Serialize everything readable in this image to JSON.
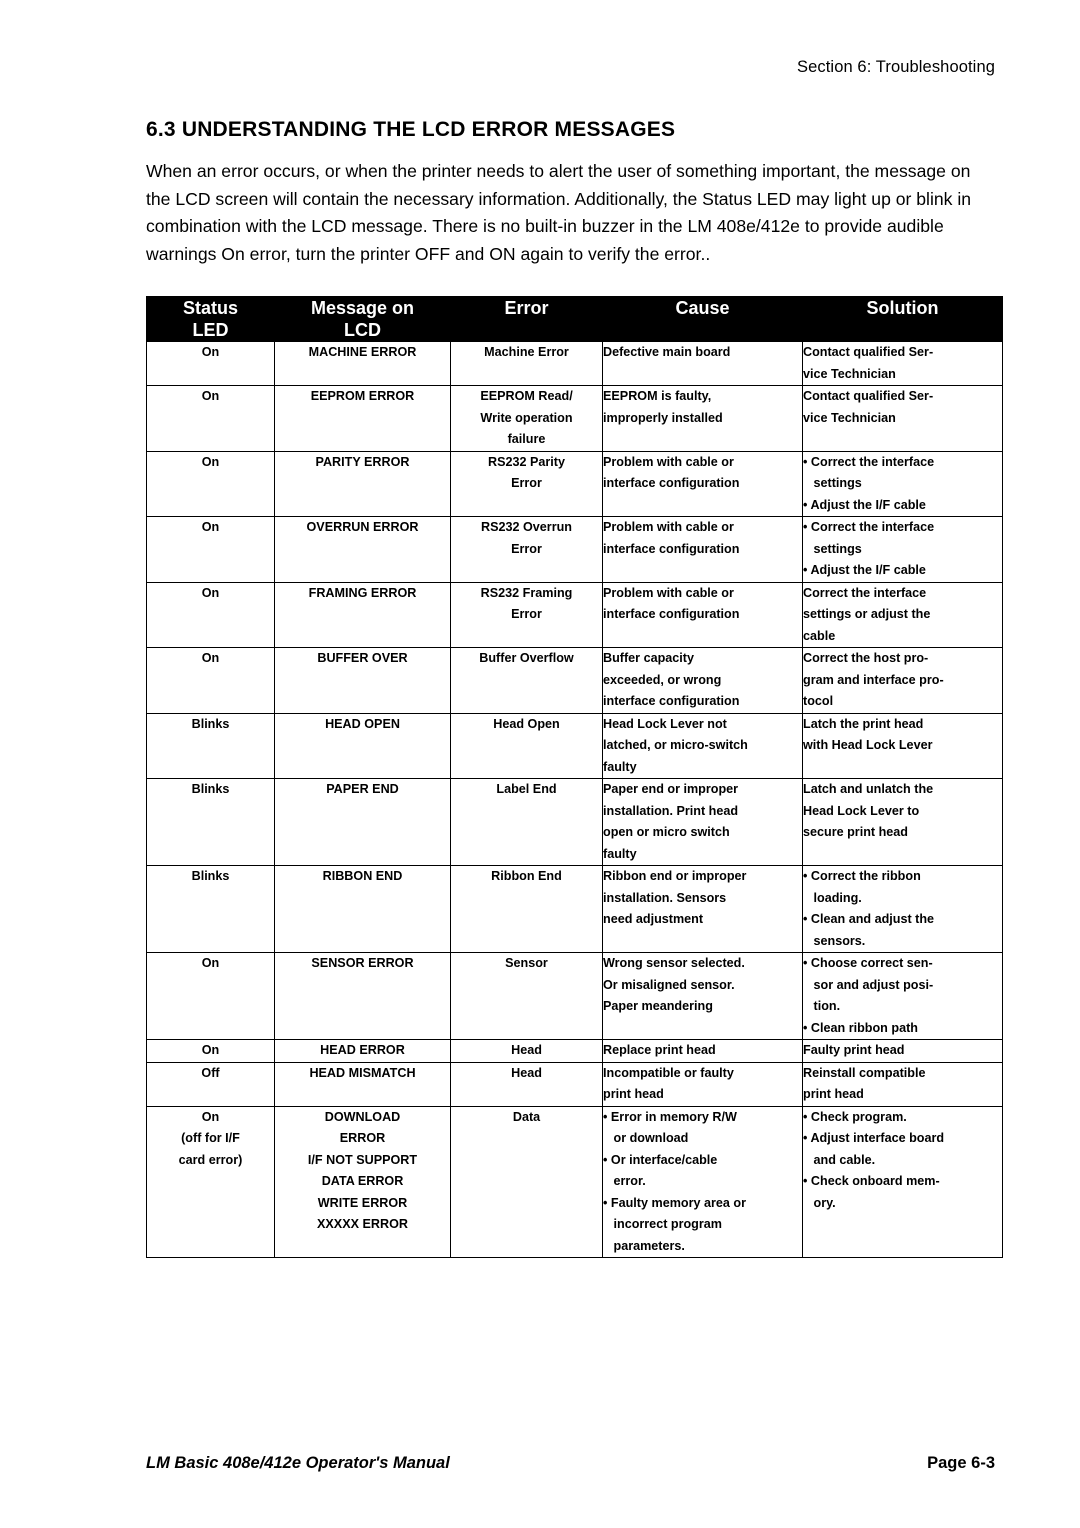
{
  "header": {
    "section_label": "Section 6: Troubleshooting"
  },
  "section": {
    "title": "6.3 UNDERSTANDING THE LCD ERROR MESSAGES",
    "paragraph": "When an error occurs, or when the printer needs to alert the user of something important, the message on the LCD screen will contain the necessary information. Additionally, the Status LED may light up or blink in combination with the LCD message. There is no built-in buzzer in the LM 408e/412e to provide audible warnings On error, turn the printer OFF and ON again to verify the error.."
  },
  "table": {
    "columns": [
      {
        "line1": "Status",
        "line2": "LED"
      },
      {
        "line1": "Message on",
        "line2": "LCD"
      },
      {
        "line1": "Error",
        "line2": ""
      },
      {
        "line1": "Cause",
        "line2": ""
      },
      {
        "line1": "Solution",
        "line2": ""
      }
    ],
    "rows": [
      {
        "status": [
          "On"
        ],
        "message": [
          "MACHINE ERROR"
        ],
        "error": [
          "Machine Error"
        ],
        "cause": [
          "Defective main board"
        ],
        "solution": [
          "Contact qualified Ser-",
          "vice Technician"
        ]
      },
      {
        "status": [
          "On"
        ],
        "message": [
          "EEPROM ERROR"
        ],
        "error": [
          "EEPROM Read/",
          "Write operation",
          "failure"
        ],
        "cause": [
          "EEPROM is faulty,",
          "improperly installed"
        ],
        "solution": [
          "Contact qualified Ser-",
          "vice Technician"
        ]
      },
      {
        "status": [
          "On"
        ],
        "message": [
          "PARITY ERROR"
        ],
        "error": [
          "RS232 Parity",
          "Error"
        ],
        "cause": [
          "Problem with cable or",
          "interface configuration"
        ],
        "solution": [
          "• Correct the interface",
          "   settings",
          "• Adjust the I/F cable"
        ]
      },
      {
        "status": [
          "On"
        ],
        "message": [
          "OVERRUN ERROR"
        ],
        "error": [
          "RS232 Overrun",
          "Error"
        ],
        "cause": [
          "Problem with cable or",
          "interface configuration"
        ],
        "solution": [
          "• Correct the interface",
          "   settings",
          "• Adjust the I/F cable"
        ]
      },
      {
        "status": [
          "On"
        ],
        "message": [
          "FRAMING ERROR"
        ],
        "error": [
          "RS232 Framing",
          "Error"
        ],
        "cause": [
          "Problem with cable or",
          "interface configuration"
        ],
        "solution": [
          "Correct the interface",
          "settings or adjust the",
          "cable"
        ]
      },
      {
        "status": [
          "On"
        ],
        "message": [
          "BUFFER OVER"
        ],
        "error": [
          "Buffer Overflow"
        ],
        "cause": [
          "Buffer capacity",
          "exceeded, or wrong",
          "interface configuration"
        ],
        "solution": [
          "Correct the host pro-",
          "gram and interface pro-",
          "tocol"
        ]
      },
      {
        "status": [
          "Blinks"
        ],
        "message": [
          "HEAD OPEN"
        ],
        "error": [
          "Head Open"
        ],
        "cause": [
          "Head Lock Lever not",
          "latched, or micro-switch",
          "faulty"
        ],
        "solution": [
          "Latch the print head",
          "with Head Lock Lever"
        ]
      },
      {
        "status": [
          "Blinks"
        ],
        "message": [
          "PAPER END"
        ],
        "error": [
          "Label End"
        ],
        "cause": [
          "Paper end or improper",
          "installation. Print head",
          "open or micro switch",
          "faulty"
        ],
        "solution": [
          "Latch and unlatch the",
          "Head Lock Lever to",
          "secure print head"
        ]
      },
      {
        "status": [
          "Blinks"
        ],
        "message": [
          "RIBBON END"
        ],
        "error": [
          "Ribbon End"
        ],
        "cause": [
          "Ribbon end or improper",
          "installation. Sensors",
          "need adjustment"
        ],
        "solution": [
          "• Correct the ribbon",
          "   loading.",
          "• Clean and adjust the",
          "   sensors."
        ]
      },
      {
        "status": [
          "On"
        ],
        "message": [
          "SENSOR ERROR"
        ],
        "error": [
          "Sensor"
        ],
        "cause": [
          "Wrong sensor selected.",
          "Or misaligned sensor.",
          "Paper meandering"
        ],
        "solution": [
          "• Choose correct sen-",
          "   sor and adjust posi-",
          "   tion.",
          "• Clean ribbon path"
        ]
      },
      {
        "status": [
          "On"
        ],
        "message": [
          "HEAD ERROR"
        ],
        "error": [
          "Head"
        ],
        "cause": [
          "Replace print head"
        ],
        "solution": [
          "Faulty print head"
        ]
      },
      {
        "status": [
          "Off"
        ],
        "message": [
          "HEAD MISMATCH"
        ],
        "error": [
          "Head"
        ],
        "cause": [
          "Incompatible or faulty",
          "print head"
        ],
        "solution": [
          "Reinstall compatible",
          "print head"
        ]
      },
      {
        "status": [
          "On",
          "(off for I/F",
          "card error)"
        ],
        "message": [
          "DOWNLOAD",
          "ERROR",
          "I/F NOT SUPPORT",
          "DATA ERROR",
          "WRITE ERROR",
          "XXXXX ERROR"
        ],
        "error": [
          "Data"
        ],
        "cause": [
          "• Error in memory R/W",
          "   or download",
          "• Or interface/cable",
          "   error.",
          "• Faulty memory area or",
          "   incorrect program",
          "   parameters."
        ],
        "solution": [
          "• Check program.",
          "• Adjust interface board",
          "   and cable.",
          "• Check onboard mem-",
          "   ory."
        ]
      }
    ]
  },
  "footer": {
    "left": "LM Basic 408e/412e Operator's Manual",
    "right": "Page 6-3"
  }
}
